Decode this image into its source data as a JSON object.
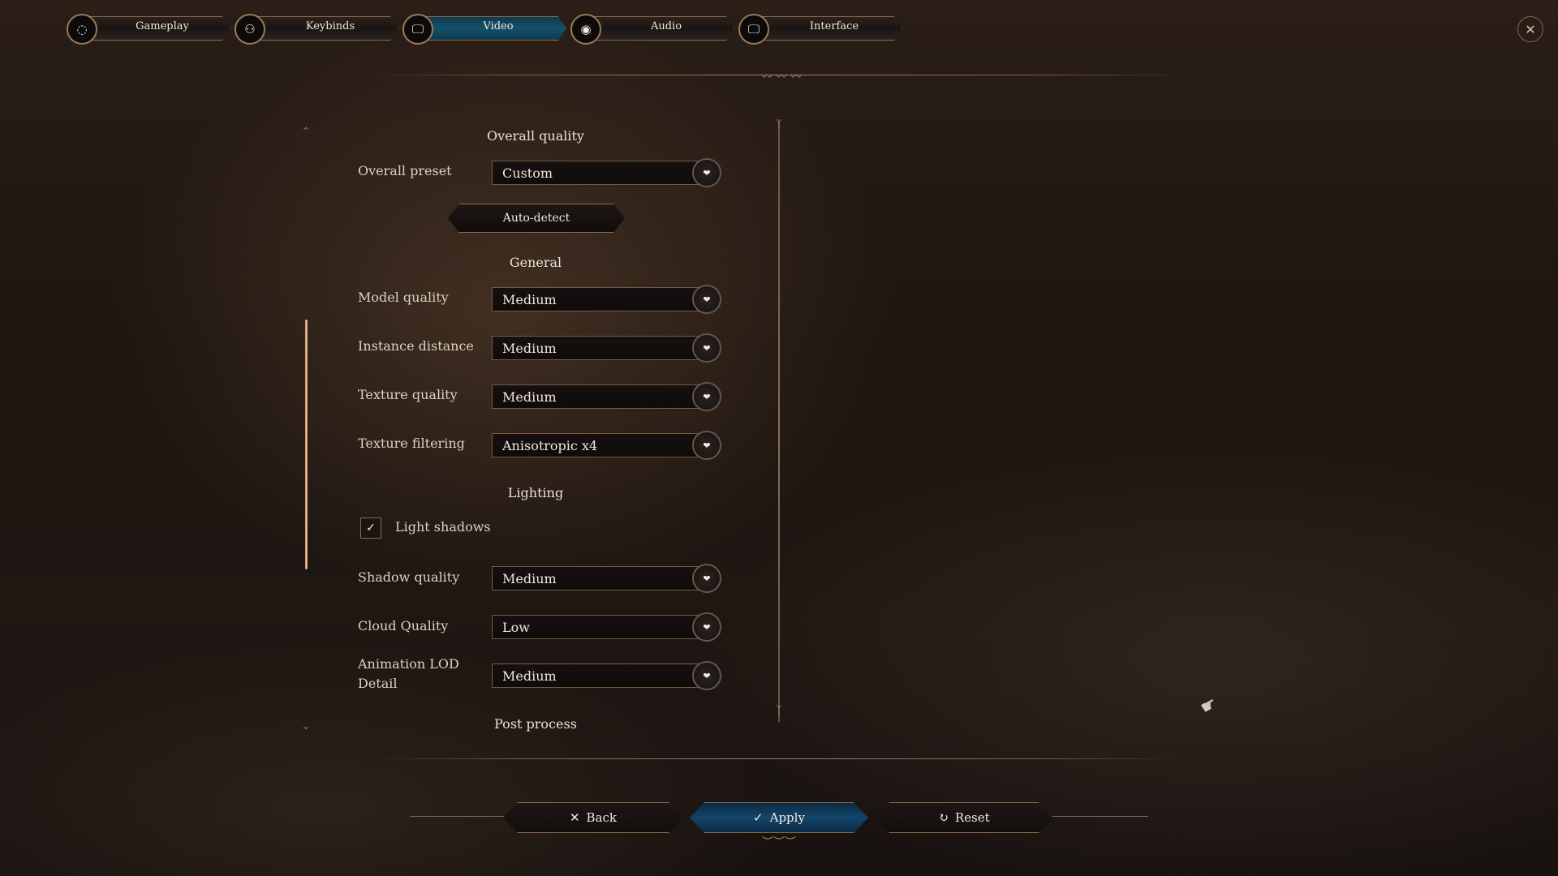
{
  "tabs": [
    {
      "label": "Gameplay",
      "icon": "gameplay-icon",
      "glyph": "◌",
      "active": false
    },
    {
      "label": "Keybinds",
      "icon": "keybinds-icon",
      "glyph": "⚇",
      "active": false
    },
    {
      "label": "Video",
      "icon": "monitor-icon",
      "glyph": "🖵",
      "active": true
    },
    {
      "label": "Audio",
      "icon": "audio-icon",
      "glyph": "◉",
      "active": false
    },
    {
      "label": "Interface",
      "icon": "monitor-icon",
      "glyph": "🖵",
      "active": false
    }
  ],
  "close_glyph": "✕",
  "sections": {
    "overall": "Overall quality",
    "general": "General",
    "lighting": "Lighting",
    "post": "Post process"
  },
  "settings": {
    "overall_preset": {
      "label": "Overall preset",
      "value": "Custom"
    },
    "auto_detect": "Auto-detect",
    "model_quality": {
      "label": "Model quality",
      "value": "Medium"
    },
    "instance_distance": {
      "label": "Instance distance",
      "value": "Medium"
    },
    "texture_quality": {
      "label": "Texture quality",
      "value": "Medium"
    },
    "texture_filtering": {
      "label": "Texture filtering",
      "value": "Anisotropic x4"
    },
    "light_shadows": {
      "label": "Light shadows",
      "checked": true,
      "glyph": "✓"
    },
    "shadow_quality": {
      "label": "Shadow quality",
      "value": "Medium"
    },
    "cloud_quality": {
      "label": "Cloud Quality",
      "value": "Low"
    },
    "animation_lod": {
      "label": "Animation LOD Detail",
      "value": "Medium"
    }
  },
  "dropdown_glyph": "❤",
  "buttons": {
    "back": {
      "label": "Back",
      "glyph": "✕"
    },
    "apply": {
      "label": "Apply",
      "glyph": "✓"
    },
    "reset": {
      "label": "Reset",
      "glyph": "↻"
    }
  },
  "colors": {
    "accent_blue": "#14456a",
    "gold_border": "#8a6848",
    "scroll_thumb": "#f0c6a2"
  }
}
